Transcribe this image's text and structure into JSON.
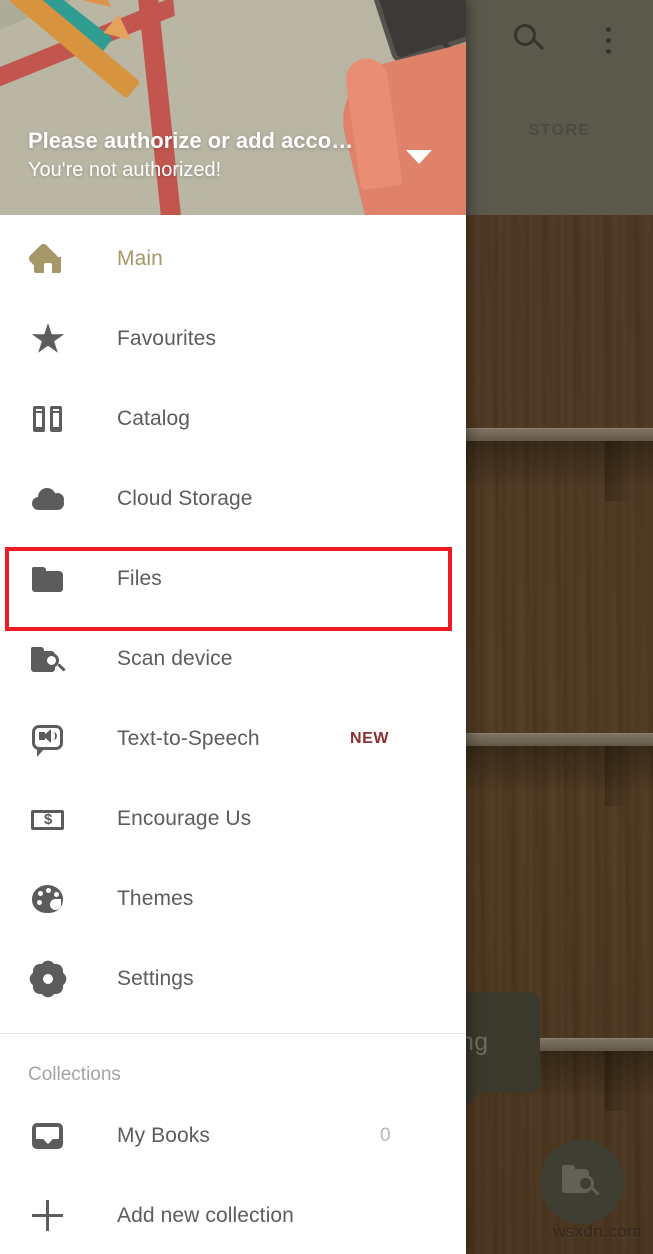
{
  "app": {
    "background": {
      "appbar": {
        "search_icon": "search-icon",
        "overflow_icon": "more-vertical-icon",
        "tab_label": "STORE"
      },
      "fab": {
        "icon": "scan-folder-icon"
      },
      "tooltip_text": "hing",
      "watermark": "wsxdn.com"
    }
  },
  "drawer": {
    "header": {
      "account_title": "Please authorize or add acco…",
      "account_subtitle": "You're not authorized!",
      "expand_icon": "chevron-down-icon"
    },
    "items": [
      {
        "label": "Main",
        "icon": "home-icon",
        "selected": true
      },
      {
        "label": "Favourites",
        "icon": "star-icon",
        "selected": false
      },
      {
        "label": "Catalog",
        "icon": "books-icon",
        "selected": false
      },
      {
        "label": "Cloud Storage",
        "icon": "cloud-icon",
        "selected": false
      },
      {
        "label": "Files",
        "icon": "folder-icon",
        "selected": false,
        "highlighted": true
      },
      {
        "label": "Scan device",
        "icon": "scan-folder-icon",
        "selected": false
      },
      {
        "label": "Text-to-Speech",
        "icon": "speech-bubble-speaker-icon",
        "selected": false,
        "badge": "NEW"
      },
      {
        "label": "Encourage Us",
        "icon": "money-bill-icon",
        "selected": false
      },
      {
        "label": "Themes",
        "icon": "palette-icon",
        "selected": false
      },
      {
        "label": "Settings",
        "icon": "gear-icon",
        "selected": false
      }
    ],
    "collections": {
      "section_label": "Collections",
      "entries": [
        {
          "label": "My Books",
          "icon": "inbox-icon",
          "count": "0"
        },
        {
          "label": "Add new collection",
          "icon": "plus-icon"
        }
      ]
    }
  },
  "colors": {
    "selected_item": "#a59767",
    "badge_new": "#8b3030",
    "highlight_box": "#ee1b24",
    "item_text": "#5c5c5c",
    "section_label": "#a3a3a3",
    "drawer_bg": "#ffffff"
  }
}
